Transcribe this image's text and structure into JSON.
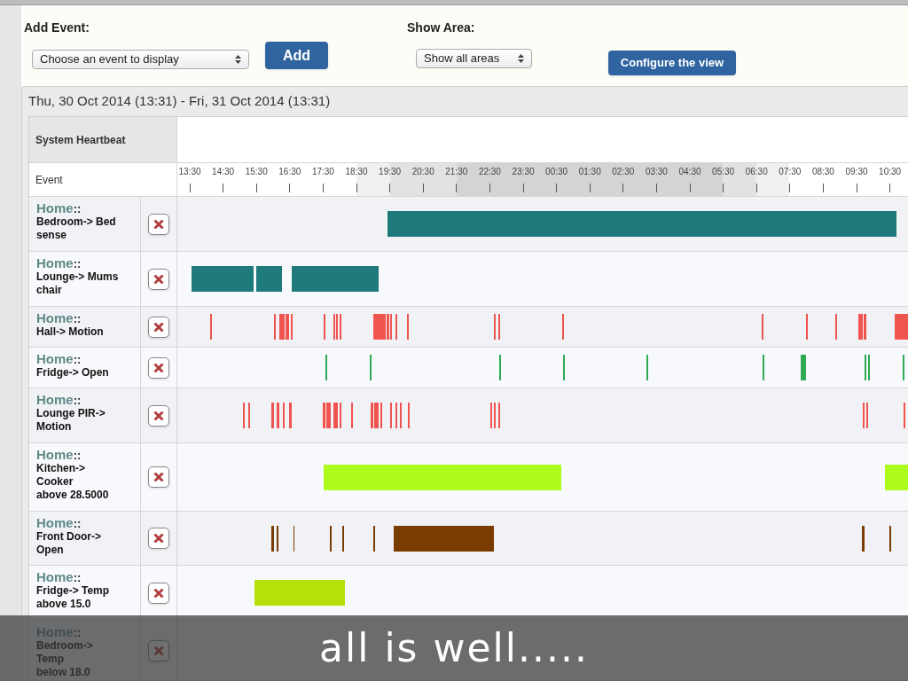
{
  "add_event": {
    "label": "Add Event:",
    "select": "Choose an event to display",
    "button": "Add"
  },
  "show_area": {
    "label": "Show Area:",
    "select": "Show all areas"
  },
  "configure_button": "Configure the view",
  "timeline": {
    "range": "Thu, 30 Oct 2014 (13:31) - Fri, 31 Oct 2014 (13:31)",
    "heartbeat_label": "System Heartbeat",
    "event_header": "Event",
    "times": [
      "13:30",
      "14:30",
      "15:30",
      "16:30",
      "17:30",
      "18:30",
      "19:30",
      "20:30",
      "21:30",
      "22:30",
      "23:30",
      "00:30",
      "01:30",
      "02:30",
      "03:30",
      "04:30",
      "05:30",
      "06:30",
      "07:30",
      "08:30",
      "09:30",
      "10:30"
    ],
    "rows": [
      {
        "prefix": "Home",
        "separator": "::",
        "lines": [
          "Bedroom-> Bed",
          "sense"
        ],
        "color": "#1f7b7b"
      },
      {
        "prefix": "Home",
        "separator": "::",
        "lines": [
          "Lounge-> Mums",
          "chair"
        ],
        "color": "#1f7b7b"
      },
      {
        "prefix": "Home",
        "separator": "::",
        "lines": [
          "Hall-> Motion"
        ],
        "color": "#f0544f"
      },
      {
        "prefix": "Home",
        "separator": "::",
        "lines": [
          "Fridge-> Open"
        ],
        "color": "#2eaa55"
      },
      {
        "prefix": "Home",
        "separator": "::",
        "lines": [
          "Lounge PIR->",
          "Motion"
        ],
        "color": "#f0544f"
      },
      {
        "prefix": "Home",
        "separator": "::",
        "lines": [
          "Kitchen->",
          "Cooker",
          "above 28.5000"
        ],
        "color": "#aefc1c"
      },
      {
        "prefix": "Home",
        "separator": "::",
        "lines": [
          "Front Door->",
          "Open"
        ],
        "color": "#7a3c00"
      },
      {
        "prefix": "Home",
        "separator": "::",
        "lines": [
          "Fridge-> Temp",
          "above 15.0"
        ],
        "color": "#b5e00a"
      },
      {
        "prefix": "Home",
        "separator": "::",
        "lines": [
          "Bedroom->",
          "Temp",
          "below 18.0"
        ]
      }
    ]
  },
  "caption": "all is well....."
}
